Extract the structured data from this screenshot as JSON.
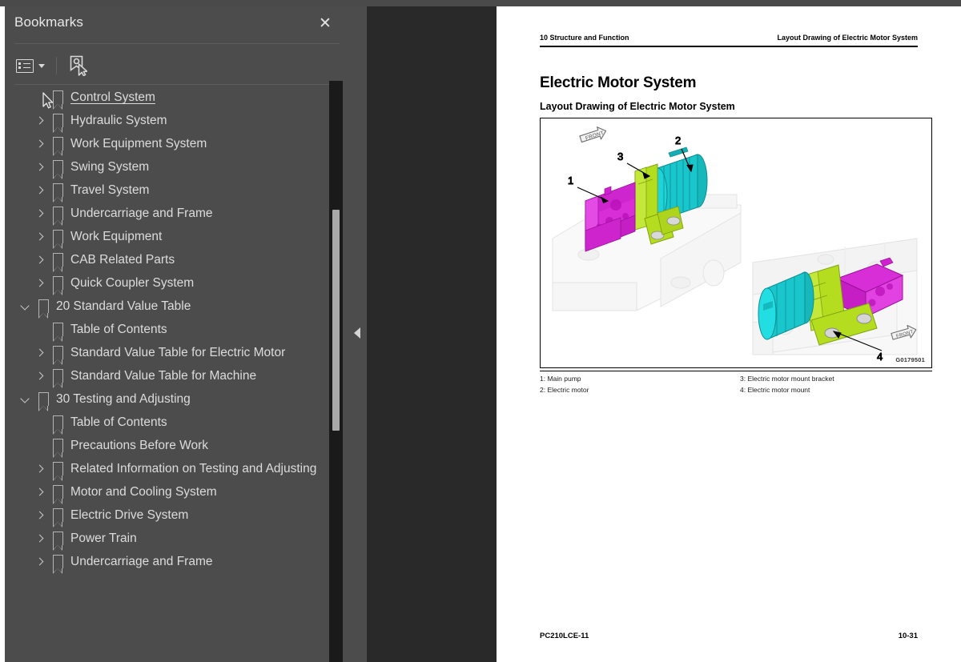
{
  "panel": {
    "title": "Bookmarks",
    "close_label": "✕",
    "toolbar": {
      "options_icon": "list-options-icon",
      "options_caret": "chevron-down-icon",
      "find_bookmark_icon": "bookmark-pointer-icon"
    }
  },
  "bookmarks": [
    {
      "label": "Control System",
      "level": 1,
      "state": "none",
      "selected": true
    },
    {
      "label": "Hydraulic System",
      "level": 1,
      "state": "collapsed",
      "selected": false
    },
    {
      "label": "Work Equipment System",
      "level": 1,
      "state": "collapsed",
      "selected": false
    },
    {
      "label": "Swing System",
      "level": 1,
      "state": "collapsed",
      "selected": false
    },
    {
      "label": "Travel System",
      "level": 1,
      "state": "collapsed",
      "selected": false
    },
    {
      "label": "Undercarriage and Frame",
      "level": 1,
      "state": "collapsed",
      "selected": false
    },
    {
      "label": "Work Equipment",
      "level": 1,
      "state": "collapsed",
      "selected": false
    },
    {
      "label": "CAB Related Parts",
      "level": 1,
      "state": "collapsed",
      "selected": false
    },
    {
      "label": "Quick Coupler System",
      "level": 1,
      "state": "collapsed",
      "selected": false
    },
    {
      "label": "20 Standard Value Table",
      "level": 0,
      "state": "expanded",
      "selected": false
    },
    {
      "label": "Table of Contents",
      "level": 1,
      "state": "none",
      "selected": false
    },
    {
      "label": "Standard Value Table for Electric Motor",
      "level": 1,
      "state": "collapsed",
      "selected": false
    },
    {
      "label": "Standard Value Table for Machine",
      "level": 1,
      "state": "collapsed",
      "selected": false
    },
    {
      "label": "30 Testing and Adjusting",
      "level": 0,
      "state": "expanded",
      "selected": false
    },
    {
      "label": "Table of Contents",
      "level": 1,
      "state": "none",
      "selected": false
    },
    {
      "label": "Precautions Before Work",
      "level": 1,
      "state": "none",
      "selected": false
    },
    {
      "label": "Related Information on Testing and Adjusting",
      "level": 1,
      "state": "collapsed",
      "selected": false
    },
    {
      "label": "Motor and Cooling System",
      "level": 1,
      "state": "collapsed",
      "selected": false
    },
    {
      "label": "Electric Drive System",
      "level": 1,
      "state": "collapsed",
      "selected": false
    },
    {
      "label": "Power Train",
      "level": 1,
      "state": "collapsed",
      "selected": false
    },
    {
      "label": "Undercarriage and Frame",
      "level": 1,
      "state": "collapsed",
      "selected": false
    }
  ],
  "document": {
    "header_left": "10 Structure and Function",
    "header_right": "Layout Drawing of Electric Motor System",
    "title": "Electric Motor System",
    "subtitle": "Layout Drawing of Electric Motor System",
    "figure_id": "G0179501",
    "figure_marker_front": "FRONT",
    "callouts": [
      "1",
      "2",
      "3",
      "4"
    ],
    "legend_left": [
      "1: Main pump",
      "2: Electric motor"
    ],
    "legend_right": [
      "3: Electric motor mount bracket",
      "4: Electric motor mount"
    ],
    "footer_left": "PC210LCE-11",
    "footer_right": "10-31"
  },
  "colors": {
    "panel_bg": "#4c4c4c",
    "gutter_bg": "#292929",
    "scroll_track": "#1a1a1a",
    "scroll_thumb": "#a8a8a8",
    "part_magenta": "#d61fd6",
    "part_cyan": "#18c2c2",
    "part_green": "#a8d61f",
    "page_bg": "#ffffff"
  }
}
